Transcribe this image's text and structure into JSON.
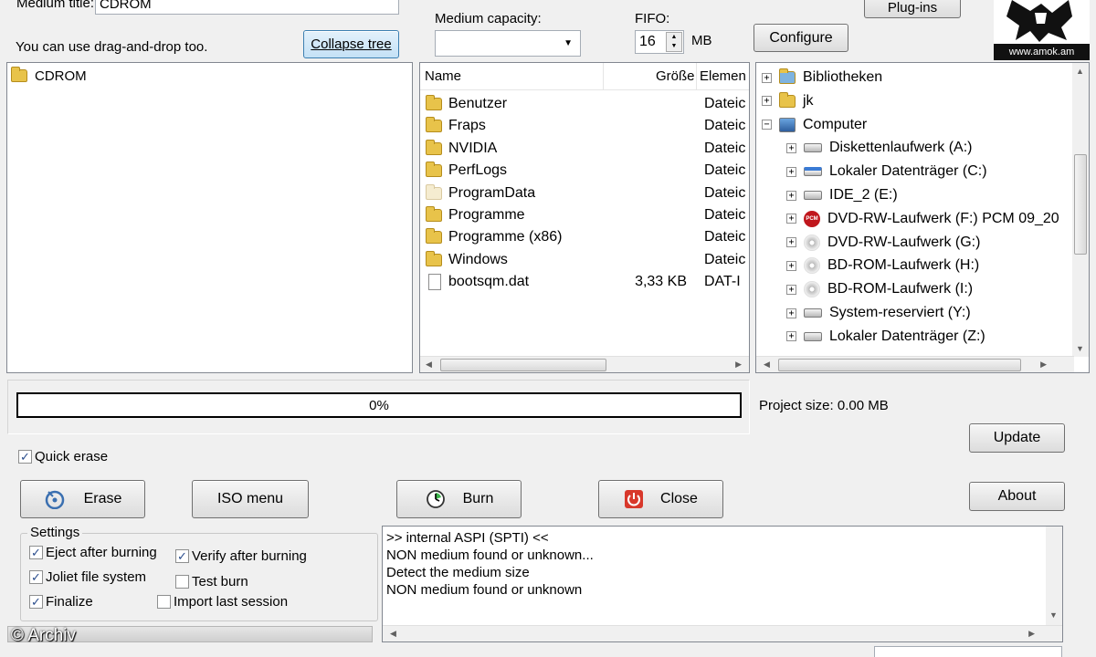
{
  "top": {
    "medium_title_label": "Medium title:",
    "medium_title_value": "CDROM",
    "dragdrop_hint": "You can use drag-and-drop too.",
    "collapse_tree_label": "Collapse tree",
    "medium_capacity_label": "Medium capacity:",
    "medium_capacity_value": "",
    "fifo_label": "FIFO:",
    "fifo_value": "16",
    "fifo_unit": "MB",
    "configure_label": "Configure",
    "plugins_label": "Plug-ins",
    "logo_text": "www.amok.am"
  },
  "project_tree": {
    "root_label": "CDROM"
  },
  "file_list": {
    "columns": [
      "Name",
      "Größe",
      "Elemen"
    ],
    "rows": [
      {
        "name": "Benutzer",
        "size": "",
        "type": "Dateic",
        "icon": "folder-icon"
      },
      {
        "name": "Fraps",
        "size": "",
        "type": "Dateic",
        "icon": "folder-icon"
      },
      {
        "name": "NVIDIA",
        "size": "",
        "type": "Dateic",
        "icon": "folder-icon"
      },
      {
        "name": "PerfLogs",
        "size": "",
        "type": "Dateic",
        "icon": "folder-icon"
      },
      {
        "name": "ProgramData",
        "size": "",
        "type": "Dateic",
        "icon": "folder-pale-icon"
      },
      {
        "name": "Programme",
        "size": "",
        "type": "Dateic",
        "icon": "folder-icon"
      },
      {
        "name": "Programme (x86)",
        "size": "",
        "type": "Dateic",
        "icon": "folder-icon"
      },
      {
        "name": "Windows",
        "size": "",
        "type": "Dateic",
        "icon": "folder-icon"
      },
      {
        "name": "bootsqm.dat",
        "size": "3,33 KB",
        "type": "DAT-I",
        "icon": "file-icon"
      }
    ]
  },
  "explorer_tree": {
    "items": [
      {
        "label": "Bibliotheken",
        "expander": "+",
        "icon": "library-icon"
      },
      {
        "label": "jk",
        "expander": "+",
        "icon": "user-folder-icon"
      },
      {
        "label": "Computer",
        "expander": "−",
        "icon": "computer-icon"
      },
      {
        "label": "Diskettenlaufwerk (A:)",
        "expander": "+",
        "icon": "floppy-icon"
      },
      {
        "label": "Lokaler Datenträger (C:)",
        "expander": "+",
        "icon": "system-drive-icon"
      },
      {
        "label": "IDE_2 (E:)",
        "expander": "+",
        "icon": "drive-icon"
      },
      {
        "label": "DVD-RW-Laufwerk (F:) PCM 09_20",
        "expander": "+",
        "icon": "pcm-disc-icon"
      },
      {
        "label": "DVD-RW-Laufwerk (G:)",
        "expander": "+",
        "icon": "dvd-drive-icon"
      },
      {
        "label": "BD-ROM-Laufwerk (H:)",
        "expander": "+",
        "icon": "dvd-drive-icon"
      },
      {
        "label": "BD-ROM-Laufwerk (I:)",
        "expander": "+",
        "icon": "dvd-drive-icon"
      },
      {
        "label": "System-reserviert (Y:)",
        "expander": "+",
        "icon": "drive-icon"
      },
      {
        "label": "Lokaler Datenträger (Z:)",
        "expander": "+",
        "icon": "drive-icon"
      }
    ]
  },
  "progress": {
    "percent_text": "0%",
    "value": 0,
    "project_size": "Project size: 0.00 MB",
    "update_label": "Update"
  },
  "options": {
    "quick_erase_label": "Quick erase",
    "quick_erase_checked": true
  },
  "actions": {
    "erase_label": "Erase",
    "iso_menu_label": "ISO menu",
    "burn_label": "Burn",
    "close_label": "Close",
    "about_label": "About"
  },
  "settings": {
    "group_label": "Settings",
    "eject_label": "Eject after burning",
    "eject_checked": true,
    "verify_label": "Verify after burning",
    "verify_checked": true,
    "joliet_label": "Joliet file system",
    "joliet_checked": true,
    "test_burn_label": "Test burn",
    "test_burn_checked": false,
    "finalize_label": "Finalize",
    "finalize_checked": true,
    "import_label": "Import last session",
    "import_checked": false
  },
  "log": {
    "lines": [
      ">> internal ASPI (SPTI) <<",
      "NON medium found or unknown...",
      "Detect the medium size",
      "NON medium found or unknown"
    ]
  },
  "watermark": "© Archiv",
  "colors": {
    "window_bg": "#f0f0f0",
    "selection_blue": "#c4e1f6",
    "checkmark": "#2a4d8d"
  }
}
